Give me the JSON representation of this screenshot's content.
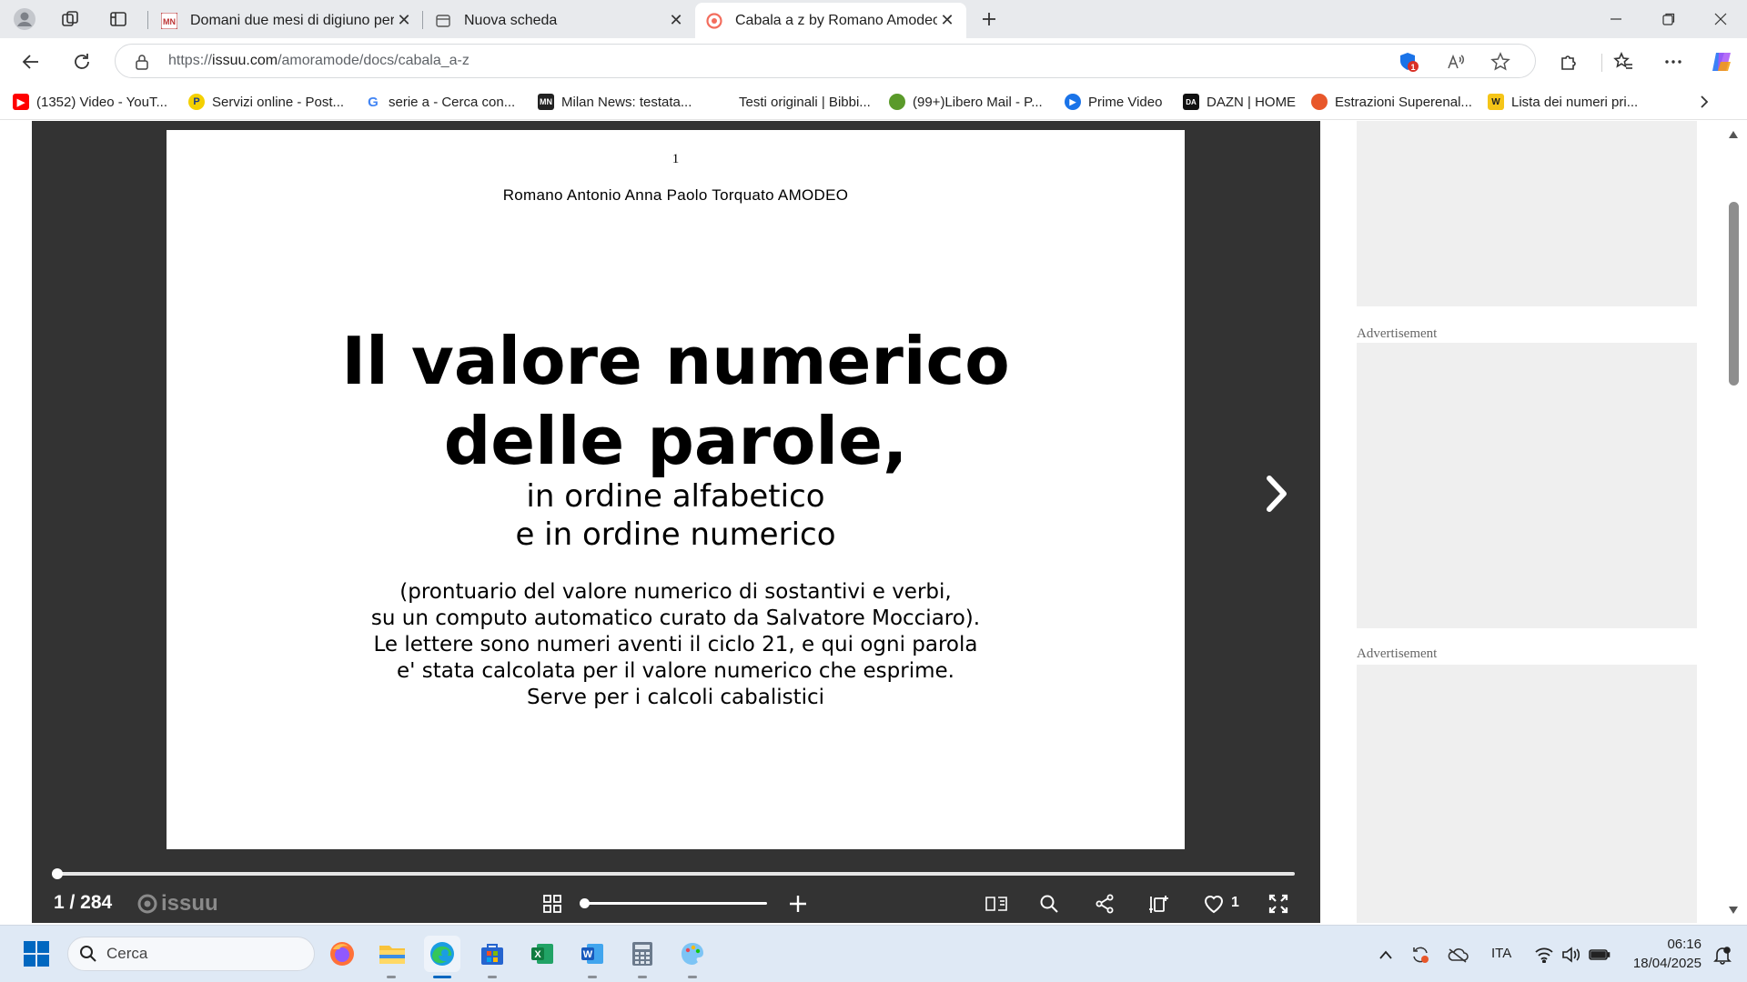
{
  "browser": {
    "tabs": [
      {
        "label": "Domani due mesi di digiuno per C",
        "active": false
      },
      {
        "label": "Nuova scheda",
        "active": false
      },
      {
        "label": "Cabala a z by Romano Amodeo -",
        "active": true
      }
    ],
    "address": {
      "url_scheme": "https://",
      "url_host": "issuu.com",
      "url_path": "/amoramode/docs/cabala_a-z",
      "extension_badge": "1"
    },
    "bookmarks": [
      {
        "label": "(1352) Video - YouT...",
        "icon": "youtube-icon"
      },
      {
        "label": "Servizi online - Post...",
        "icon": "poste-icon"
      },
      {
        "label": "serie a - Cerca con...",
        "icon": "google-icon"
      },
      {
        "label": "Milan News: testata...",
        "icon": "milannews-icon"
      },
      {
        "label": "Testi originali | Bibbi...",
        "icon": "page-icon"
      },
      {
        "label": "(99+)Libero Mail - P...",
        "icon": "libero-icon"
      },
      {
        "label": "Prime Video",
        "icon": "primevideo-icon"
      },
      {
        "label": "DAZN | HOME",
        "icon": "dazn-icon"
      },
      {
        "label": "Estrazioni Superenal...",
        "icon": "superenalotto-icon"
      },
      {
        "label": "Lista dei numeri pri...",
        "icon": "list-icon"
      }
    ]
  },
  "document": {
    "page_number": "1",
    "author": "Romano Antonio Anna Paolo Torquato AMODEO",
    "title_line1": "Il valore numerico",
    "title_line2": "delle parole,",
    "subtitle_line1": "in ordine alfabetico",
    "subtitle_line2": "e in ordine numerico",
    "desc_line1": "(prontuario del valore numerico di sostantivi e verbi,",
    "desc_line2": "su un computo automatico curato da Salvatore Mocciaro).",
    "desc_line3": "Le lettere sono numeri aventi il ciclo 21, e qui ogni parola",
    "desc_line4": "e' stata calcolata per il valore numerico che esprime.",
    "desc_line5": "Serve per i calcoli cabalistici"
  },
  "viewer": {
    "page_indicator": "1 / 284",
    "logo_text": "issuu",
    "likes": "1",
    "progress_fraction": 0.0,
    "zoom_fraction": 0.0
  },
  "sidebar": {
    "ad_label_1": "Advertisement",
    "ad_label_2": "Advertisement"
  },
  "taskbar": {
    "search_placeholder": "Cerca",
    "language": "ITA",
    "time": "06:16",
    "date": "18/04/2025"
  },
  "colors": {
    "viewer_bg": "#333333",
    "accent": "#0067c0",
    "tab_bar": "#e8eaed"
  }
}
